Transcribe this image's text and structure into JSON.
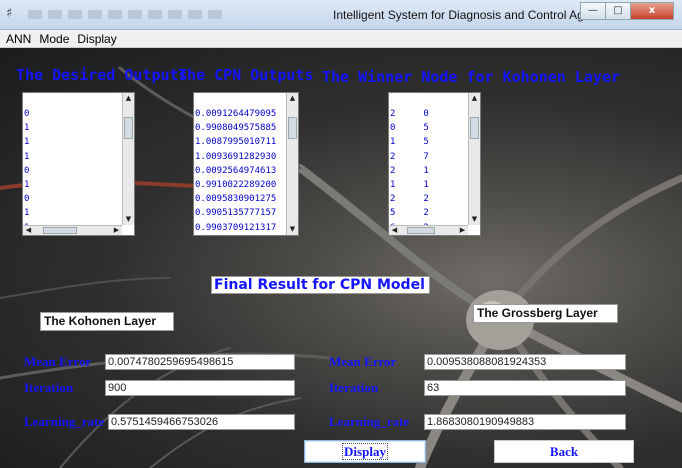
{
  "window": {
    "title": "Intelligent System for Diagnosis and Control Agricultural",
    "close_glyph": "x"
  },
  "menu": [
    "ANN",
    "Mode",
    "Display"
  ],
  "headings": {
    "desired_outputs": "The Desired Outputs",
    "cpn_outputs": "The CPN Outputs",
    "winner_node": "The Winner Node for Kohonen Layer"
  },
  "lists": {
    "desired": [
      "0",
      "1",
      "1",
      "1",
      "0",
      "1",
      "0",
      "1",
      "1"
    ],
    "cpn": [
      "0.0091264479095",
      "0.9908049575885",
      "1.0087995010711",
      "1.0093691282930",
      "0.0092564974613",
      "0.9910022289200",
      "0.0095830901275",
      "0.9905135777157",
      "0.9903709121317"
    ],
    "winner_col1": [
      "2",
      "0",
      "1",
      "2",
      "2",
      "1",
      "2",
      "5",
      "6"
    ],
    "winner_col2": [
      "0",
      "5",
      "5",
      "7",
      "1",
      "1",
      "2",
      "2",
      "2"
    ]
  },
  "final_result_label": "Final Result for CPN Model",
  "kohonen": {
    "title": "The Kohonen Layer",
    "mean_error_label": "Mean Error",
    "mean_error": "0.0074780259695498615",
    "iteration_label": "Iteration",
    "iteration": "900",
    "learning_rate_label": "Learning_rate",
    "learning_rate": "0.5751459466753026"
  },
  "grossberg": {
    "title": "The Grossberg Layer",
    "mean_error_label": "Mean Error",
    "mean_error": "0.009538088081924353",
    "iteration_label": "Iteration",
    "iteration": "63",
    "learning_rate_label": "Learning_rate",
    "learning_rate": "1.8683080190949883"
  },
  "buttons": {
    "display": "Display",
    "back": "Back"
  },
  "colors": {
    "accent_text": "#1414ff",
    "list_text": "#0000c8"
  },
  "icons": {
    "app": "app-icon",
    "minimize": "minimize-icon",
    "maximize": "maximize-icon",
    "close": "close-icon"
  }
}
